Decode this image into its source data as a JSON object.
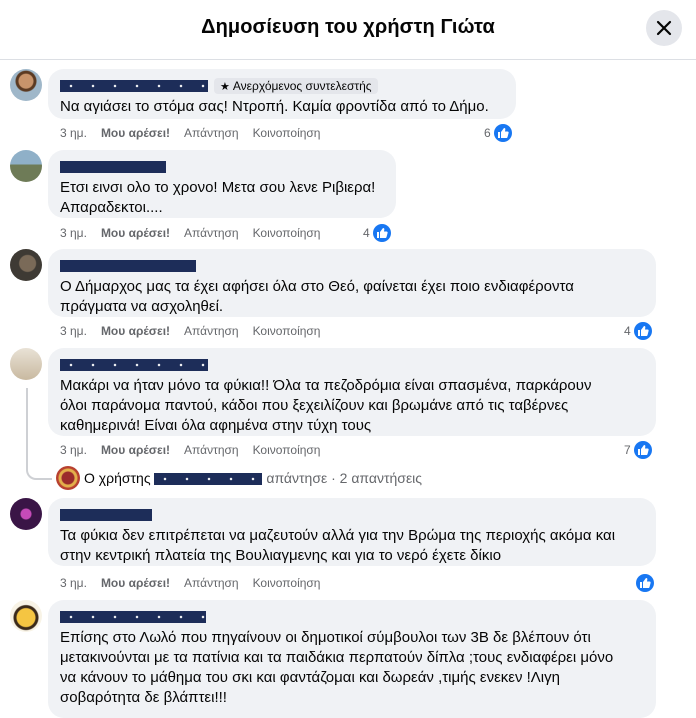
{
  "header": {
    "title": "Δημοσίευση του χρήστη Γιώτα"
  },
  "colors": {
    "accent": "#1877f2",
    "bubble": "#f0f2f5",
    "meta": "#65676b"
  },
  "actions": {
    "time": "3 ημ.",
    "like": "Μου αρέσει!",
    "reply": "Απάντηση",
    "share": "Κοινοποίηση"
  },
  "comments": [
    {
      "badge": "Ανερχόμενος συντελεστής",
      "text": "Να αγιάσει το στόμα σας! Ντροπή. Καμία φροντίδα από το Δήμο.",
      "reactions": "6"
    },
    {
      "text_lines": [
        "Ετσι εινσι ολο το χρονο! Μετα σου λενε Ριβιερα!",
        "Απαραδεκτοι...."
      ],
      "reactions": "4"
    },
    {
      "text_lines": [
        "Ο Δήμαρχος μας τα έχει αφήσει όλα στο Θεό, φαίνεται έχει ποιο ενδιαφέροντα",
        "πράγματα να ασχοληθεί."
      ],
      "reactions": "4"
    },
    {
      "text_lines": [
        "Μακάρι να ήταν μόνο τα φύκια!! Όλα τα πεζοδρόμια είναι σπασμένα, παρκάρουν",
        "όλοι παράνομα παντού, κάδοι που ξεχειλίζουν και βρωμάνε από τις ταβέρνες",
        "καθημερινά! Είναι όλα αφημένα στην τύχη τους"
      ],
      "reactions": "7"
    },
    {
      "text_lines": [
        "Τα φύκια δεν επιτρέπεται να μαζευτούν αλλά για την Βρώμα της περιοχής ακόμα και",
        "στην κεντρική πλατεία της Βουλιαγμενης και για το νερό έχετε δίκιο"
      ],
      "reactions": ""
    },
    {
      "text_lines": [
        "Επίσης στο Λωλό που πηγαίνουν οι δημοτικοί σύμβουλοι των 3Β δε βλέπουν ότι",
        "μετακινούνται με τα πατίνια και τα παιδάκια περπατούν δίπλα ;τους ενδιαφέρει μόνο",
        "να κάνουν το μάθημα του σκι και φαντάζομαι και δωρεάν ,τιμής ενεκεν !Λιγη",
        "σοβαρότητα δε βλάπτει!!!"
      ]
    }
  ],
  "replies_summary": {
    "prefix": "Ο χρήστης",
    "suffix": "απάντησε · 2 απαντήσεις"
  }
}
